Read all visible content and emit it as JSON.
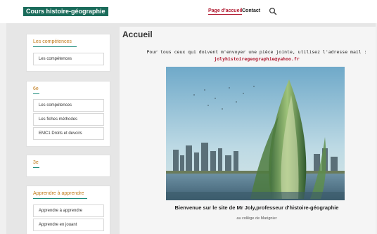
{
  "header": {
    "logo_text": "Cours histoire-géographie",
    "nav": [
      {
        "label": "Page d'accueil",
        "active": true
      },
      {
        "label": "Contact",
        "active": false
      }
    ],
    "search_icon": "search-icon"
  },
  "sidebar": {
    "cards": [
      {
        "title": "Les compétences",
        "items": [
          "Les compétences"
        ]
      },
      {
        "title": "6e",
        "items": [
          "Les compétences",
          "Les fiches méthodes",
          "EMC1 Droits et devoirs"
        ]
      },
      {
        "title": "3e",
        "items": []
      },
      {
        "title": "Apprendre à apprendre",
        "items": [
          "Apprendre à apprendre",
          "Apprendre en jouant"
        ]
      }
    ]
  },
  "main": {
    "title": "Accueil",
    "intro_text": "Pour tous ceux qui doivent m'envoyer une pièce jointe, utilisez l'adresse mail :",
    "email": "jolyhistoiregeographie@yahoo.fr",
    "welcome": "Bienvenue sur le site de Mr Joly,professeur d'histoire-géographie",
    "college": "au collège de Marignier"
  },
  "colors": {
    "brand": "#1a6b5a",
    "accent": "#b0182f",
    "sidebar_title": "#c07a1a"
  }
}
